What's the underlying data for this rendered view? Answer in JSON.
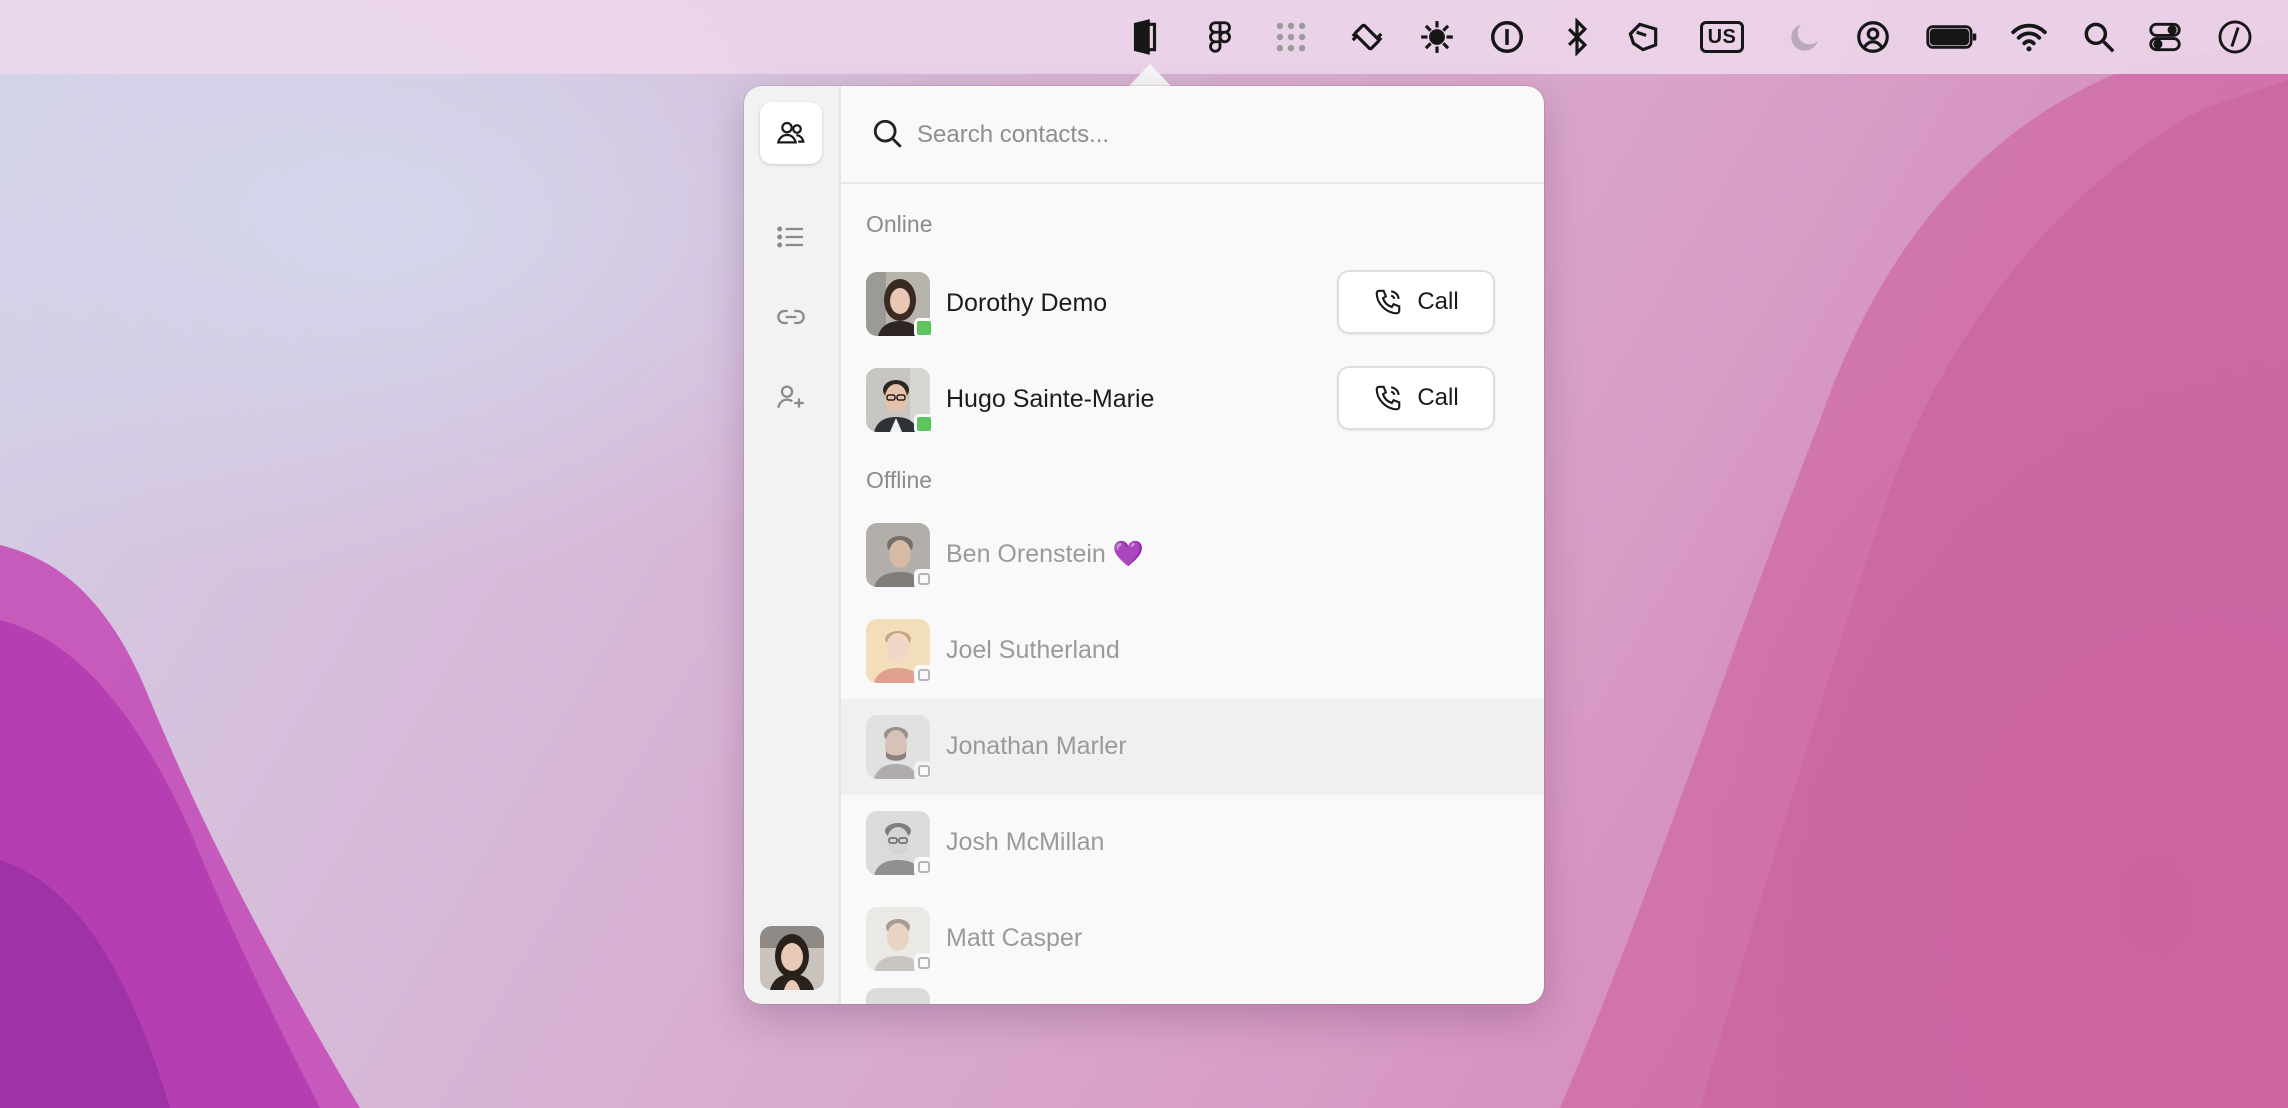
{
  "menubar": {
    "keyboard_layout": "US"
  },
  "search": {
    "placeholder": "Search contacts..."
  },
  "sections": {
    "online_label": "Online",
    "offline_label": "Offline"
  },
  "call_label": "Call",
  "contacts_online": [
    {
      "name": "Dorothy Demo",
      "status": "online"
    },
    {
      "name": "Hugo Sainte-Marie",
      "status": "online"
    }
  ],
  "contacts_offline": [
    {
      "name": "Ben Orenstein 💜",
      "status": "offline"
    },
    {
      "name": "Joel Sutherland",
      "status": "offline"
    },
    {
      "name": "Jonathan Marler",
      "status": "offline"
    },
    {
      "name": "Josh McMillan",
      "status": "offline"
    },
    {
      "name": "Matt Casper",
      "status": "offline"
    }
  ],
  "colors": {
    "online_status": "#5fc35f",
    "accent_text": "#1c1c1c",
    "muted_text": "#9a9a9a"
  }
}
